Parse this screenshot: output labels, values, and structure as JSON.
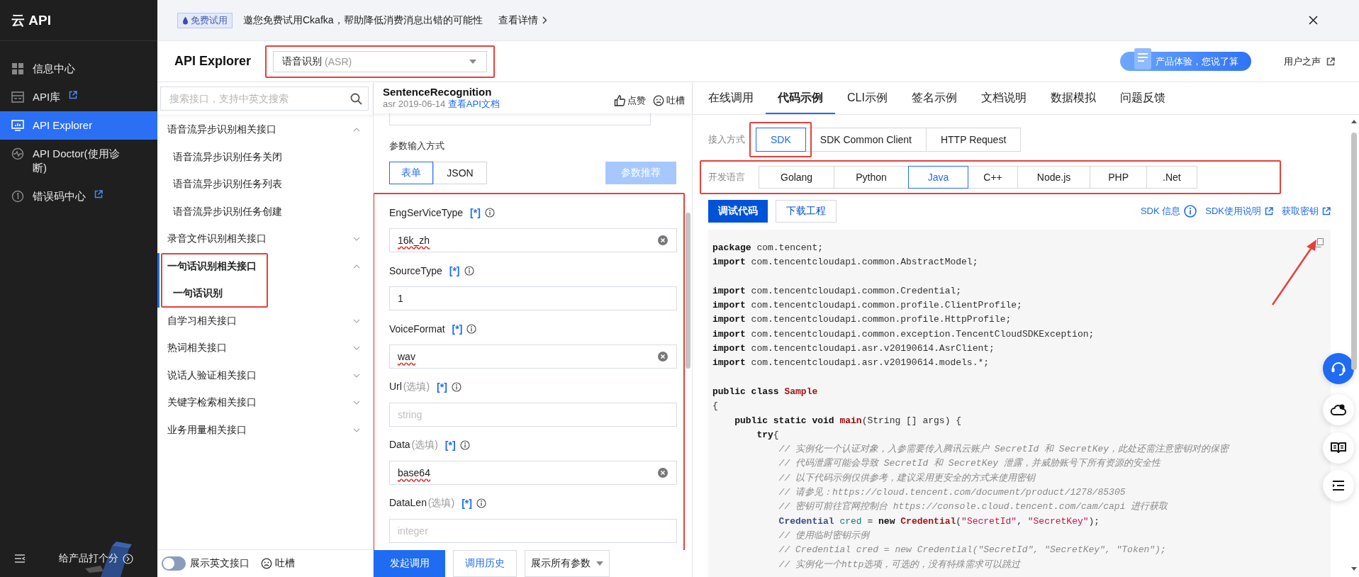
{
  "sidebar": {
    "logo": "云 API",
    "items": [
      {
        "label": "信息中心",
        "external": false,
        "selected": false
      },
      {
        "label": "API库",
        "external": true,
        "selected": false
      },
      {
        "label": "API Explorer",
        "external": false,
        "selected": true
      },
      {
        "label": "API Doctor(使用诊断)",
        "external": false,
        "selected": false
      },
      {
        "label": "错误码中心",
        "external": true,
        "selected": false
      }
    ],
    "footer": "给产品打个分"
  },
  "banner": {
    "badge": "免费试用",
    "message": "邀您免费试用Ckafka，帮助降低消费消息出错的可能性",
    "link": "查看详情"
  },
  "header": {
    "title": "API Explorer",
    "product_select": {
      "value": "语音识别",
      "hint": "(ASR)",
      "highlighted": true
    },
    "feedback_pill": "产品体验，您说了算",
    "voice_link": "用户之声"
  },
  "api_list": {
    "search_placeholder": "搜索接口，支持中英文搜索",
    "groups": [
      {
        "label": "语音流异步识别相关接口",
        "expanded": true,
        "selected": false,
        "highlighted": false,
        "children": [
          {
            "label": "语音流异步识别任务关闭",
            "selected": false
          },
          {
            "label": "语音流异步识别任务列表",
            "selected": false
          },
          {
            "label": "语音流异步识别任务创建",
            "selected": false
          }
        ]
      },
      {
        "label": "录音文件识别相关接口",
        "expanded": false,
        "selected": false,
        "highlighted": false
      },
      {
        "label": "一句话识别相关接口",
        "expanded": true,
        "selected": true,
        "highlighted": true,
        "children": [
          {
            "label": "一句话识别",
            "selected": true
          }
        ]
      },
      {
        "label": "自学习相关接口",
        "expanded": false,
        "selected": false,
        "highlighted": false
      },
      {
        "label": "热词相关接口",
        "expanded": false,
        "selected": false,
        "highlighted": false
      },
      {
        "label": "说话人验证相关接口",
        "expanded": false,
        "selected": false,
        "highlighted": false
      },
      {
        "label": "关键字检索相关接口",
        "expanded": false,
        "selected": false,
        "highlighted": false
      },
      {
        "label": "业务用量相关接口",
        "expanded": false,
        "selected": false,
        "highlighted": false
      }
    ],
    "english_toggle": {
      "label": "展示英文接口",
      "on": false
    },
    "complain": "吐槽"
  },
  "params": {
    "api_name": "SentenceRecognition",
    "service": "asr",
    "version": "2019-06-14",
    "doc_link": "查看API文档",
    "like": "点赞",
    "complain": "吐槽",
    "input_mode_label": "参数输入方式",
    "modes": [
      {
        "label": "表单",
        "selected": true
      },
      {
        "label": "JSON",
        "selected": false
      }
    ],
    "recommend": {
      "label": "参数推荐",
      "disabled": true
    },
    "highlighted": true,
    "fields": [
      {
        "name": "EngSerViceType",
        "required_mark": "[*]",
        "value": "16k_zh",
        "misspelled": true,
        "clearable": true
      },
      {
        "name": "SourceType",
        "required_mark": "[*]",
        "value": "1",
        "misspelled": false,
        "clearable": false
      },
      {
        "name": "VoiceFormat",
        "required_mark": "[*]",
        "value": "wav",
        "misspelled": true,
        "clearable": true
      },
      {
        "name": "Url",
        "note": "(选填)",
        "required_mark": "[*]",
        "placeholder": "string"
      },
      {
        "name": "Data",
        "note": "(选填)",
        "required_mark": "[*]",
        "value": "base64",
        "misspelled": true,
        "clearable": true
      },
      {
        "name": "DataLen",
        "note": "(选填)",
        "required_mark": "[*]",
        "placeholder": "integer"
      }
    ],
    "actions": {
      "invoke": "发起调用",
      "history": "调用历史",
      "show_all": "展示所有参数"
    }
  },
  "code_panel": {
    "tabs": [
      {
        "label": "在线调用",
        "selected": false
      },
      {
        "label": "代码示例",
        "selected": true
      },
      {
        "label": "CLI示例",
        "selected": false
      },
      {
        "label": "签名示例",
        "selected": false
      },
      {
        "label": "文档说明",
        "selected": false
      },
      {
        "label": "数据模拟",
        "selected": false
      },
      {
        "label": "问题反馈",
        "selected": false
      }
    ],
    "access": {
      "label": "接入方式",
      "options": [
        {
          "label": "SDK",
          "selected": true,
          "highlighted": true
        },
        {
          "label": "SDK Common Client",
          "selected": false,
          "highlighted": false
        },
        {
          "label": "HTTP Request",
          "selected": false,
          "highlighted": false
        }
      ]
    },
    "language": {
      "label": "开发语言",
      "highlighted": true,
      "options": [
        {
          "label": "Golang",
          "selected": false
        },
        {
          "label": "Python",
          "selected": false
        },
        {
          "label": "Java",
          "selected": true
        },
        {
          "label": "C++",
          "selected": false
        },
        {
          "label": "Node.js",
          "selected": false
        },
        {
          "label": "PHP",
          "selected": false
        },
        {
          "label": ".Net",
          "selected": false
        }
      ]
    },
    "debug_button": "调试代码",
    "download_button": "下载工程",
    "links": [
      {
        "label": "SDK 信息",
        "kind": "info"
      },
      {
        "label": "SDK使用说明",
        "kind": "external"
      },
      {
        "label": "获取密钥",
        "kind": "external"
      }
    ],
    "code": {
      "arrow": true,
      "lines": [
        {
          "kind": "code",
          "tokens": [
            {
              "kind": "keyword",
              "text": "package"
            },
            {
              "kind": "plain",
              "text": " com.tencent;"
            }
          ]
        },
        {
          "kind": "code",
          "tokens": [
            {
              "kind": "keyword",
              "text": "import"
            },
            {
              "kind": "plain",
              "text": " com.tencentcloudapi.common.AbstractModel;"
            }
          ]
        },
        {
          "kind": "blank"
        },
        {
          "kind": "code",
          "tokens": [
            {
              "kind": "keyword",
              "text": "import"
            },
            {
              "kind": "plain",
              "text": " com.tencentcloudapi.common.Credential;"
            }
          ]
        },
        {
          "kind": "code",
          "tokens": [
            {
              "kind": "keyword",
              "text": "import"
            },
            {
              "kind": "plain",
              "text": " com.tencentcloudapi.common.profile.ClientProfile;"
            }
          ]
        },
        {
          "kind": "code",
          "tokens": [
            {
              "kind": "keyword",
              "text": "import"
            },
            {
              "kind": "plain",
              "text": " com.tencentcloudapi.common.profile.HttpProfile;"
            }
          ]
        },
        {
          "kind": "code",
          "tokens": [
            {
              "kind": "keyword",
              "text": "import"
            },
            {
              "kind": "plain",
              "text": " com.tencentcloudapi.common.exception.TencentCloudSDKException;"
            }
          ]
        },
        {
          "kind": "code",
          "tokens": [
            {
              "kind": "keyword",
              "text": "import"
            },
            {
              "kind": "plain",
              "text": " com.tencentcloudapi.asr.v20190614.AsrClient;"
            }
          ]
        },
        {
          "kind": "code",
          "tokens": [
            {
              "kind": "keyword",
              "text": "import"
            },
            {
              "kind": "plain",
              "text": " com.tencentcloudapi.asr.v20190614.models.*;"
            }
          ]
        },
        {
          "kind": "blank"
        },
        {
          "kind": "code",
          "tokens": [
            {
              "kind": "keyword",
              "text": "public class "
            },
            {
              "kind": "class",
              "text": "Sample"
            }
          ]
        },
        {
          "kind": "code",
          "tokens": [
            {
              "kind": "plain",
              "text": "{"
            }
          ]
        },
        {
          "kind": "code",
          "tokens": [
            {
              "kind": "keyword",
              "text": "    public static void "
            },
            {
              "kind": "function",
              "text": "main"
            },
            {
              "kind": "plain",
              "text": "(String [] args) {"
            }
          ]
        },
        {
          "kind": "code",
          "tokens": [
            {
              "kind": "keyword",
              "text": "        try"
            },
            {
              "kind": "plain",
              "text": "{"
            }
          ]
        },
        {
          "kind": "code",
          "tokens": [
            {
              "kind": "comment",
              "text": "            // 实例化一个认证对象，入参需要传入腾讯云账户 SecretId 和 SecretKey，此处还需注意密钥对的保密"
            }
          ]
        },
        {
          "kind": "code",
          "tokens": [
            {
              "kind": "comment",
              "text": "            // 代码泄露可能会导致 SecretId 和 SecretKey 泄露，并威胁账号下所有资源的安全性"
            }
          ]
        },
        {
          "kind": "code",
          "tokens": [
            {
              "kind": "comment",
              "text": "            // 以下代码示例仅供参考，建议采用更安全的方式来使用密钥"
            }
          ]
        },
        {
          "kind": "code",
          "tokens": [
            {
              "kind": "comment",
              "text": "            // 请参见：https://cloud.tencent.com/document/product/1278/85305"
            }
          ]
        },
        {
          "kind": "code",
          "tokens": [
            {
              "kind": "comment",
              "text": "            // 密钥可前往官网控制台 https://console.cloud.tencent.com/cam/capi 进行获取"
            }
          ]
        },
        {
          "kind": "code",
          "tokens": [
            {
              "kind": "type",
              "text": "            Credential "
            },
            {
              "kind": "variable",
              "text": "cred"
            },
            {
              "kind": "plain",
              "text": " = "
            },
            {
              "kind": "keyword",
              "text": "new "
            },
            {
              "kind": "class",
              "text": "Credential"
            },
            {
              "kind": "plain",
              "text": "("
            },
            {
              "kind": "string",
              "text": "\"SecretId\""
            },
            {
              "kind": "plain",
              "text": ", "
            },
            {
              "kind": "string",
              "text": "\"SecretKey\""
            },
            {
              "kind": "plain",
              "text": ");"
            }
          ]
        },
        {
          "kind": "code",
          "tokens": [
            {
              "kind": "comment",
              "text": "            // 使用临时密钥示例"
            }
          ]
        },
        {
          "kind": "code",
          "tokens": [
            {
              "kind": "comment",
              "text": "            // Credential cred = new Credential(\"SecretId\", \"SecretKey\", \"Token\");"
            }
          ]
        },
        {
          "kind": "code",
          "tokens": [
            {
              "kind": "comment",
              "text": "            // 实例化一个http选项，可选的，没有特殊需求可以跳过"
            }
          ]
        }
      ]
    }
  }
}
